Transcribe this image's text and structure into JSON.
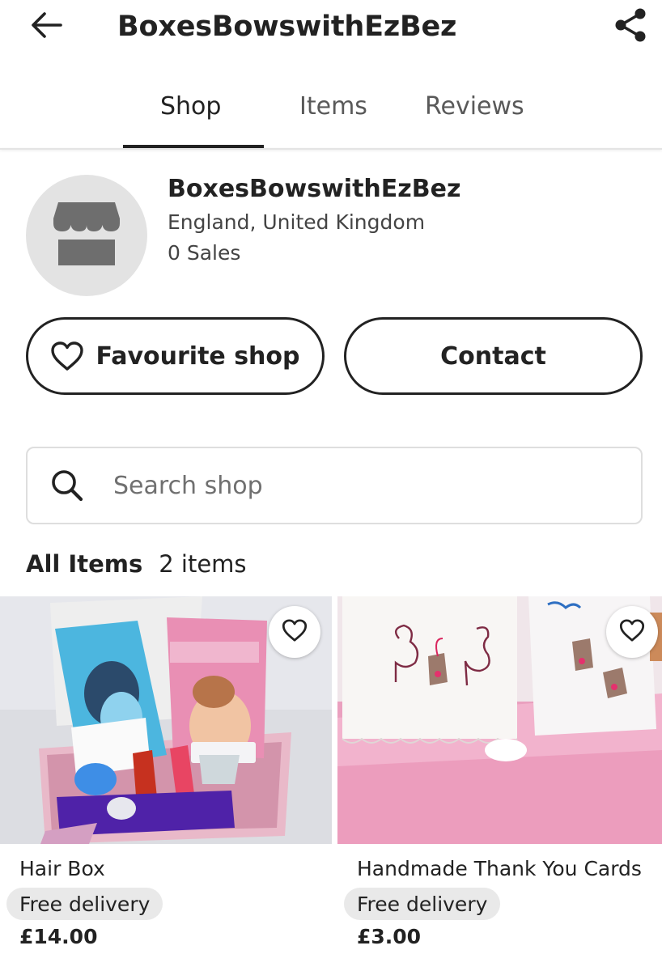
{
  "header": {
    "title": "BoxesBowswithEzBez",
    "back_icon": "arrow-left-icon",
    "share_icon": "share-icon"
  },
  "tabs": [
    {
      "label": "Shop",
      "active": true
    },
    {
      "label": "Items",
      "active": false
    },
    {
      "label": "Reviews",
      "active": false
    }
  ],
  "shop": {
    "name": "BoxesBowswithEzBez",
    "location": "England, United Kingdom",
    "sales": "0 Sales",
    "avatar_icon": "storefront-icon"
  },
  "actions": {
    "favourite_label": "Favourite shop",
    "contact_label": "Contact"
  },
  "search": {
    "placeholder": "Search shop",
    "value": ""
  },
  "items_section": {
    "title": "All Items",
    "count": "2 items"
  },
  "listings": [
    {
      "title": "Hair Box",
      "delivery": "Free delivery",
      "price": "£14.00"
    },
    {
      "title": "Handmade Thank You Cards",
      "delivery": "Free delivery",
      "price": "£3.00"
    }
  ],
  "colors": {
    "text": "#222222",
    "muted": "#595959",
    "badge_bg": "#e9e9e9",
    "avatar_bg": "#e3e3e3"
  }
}
